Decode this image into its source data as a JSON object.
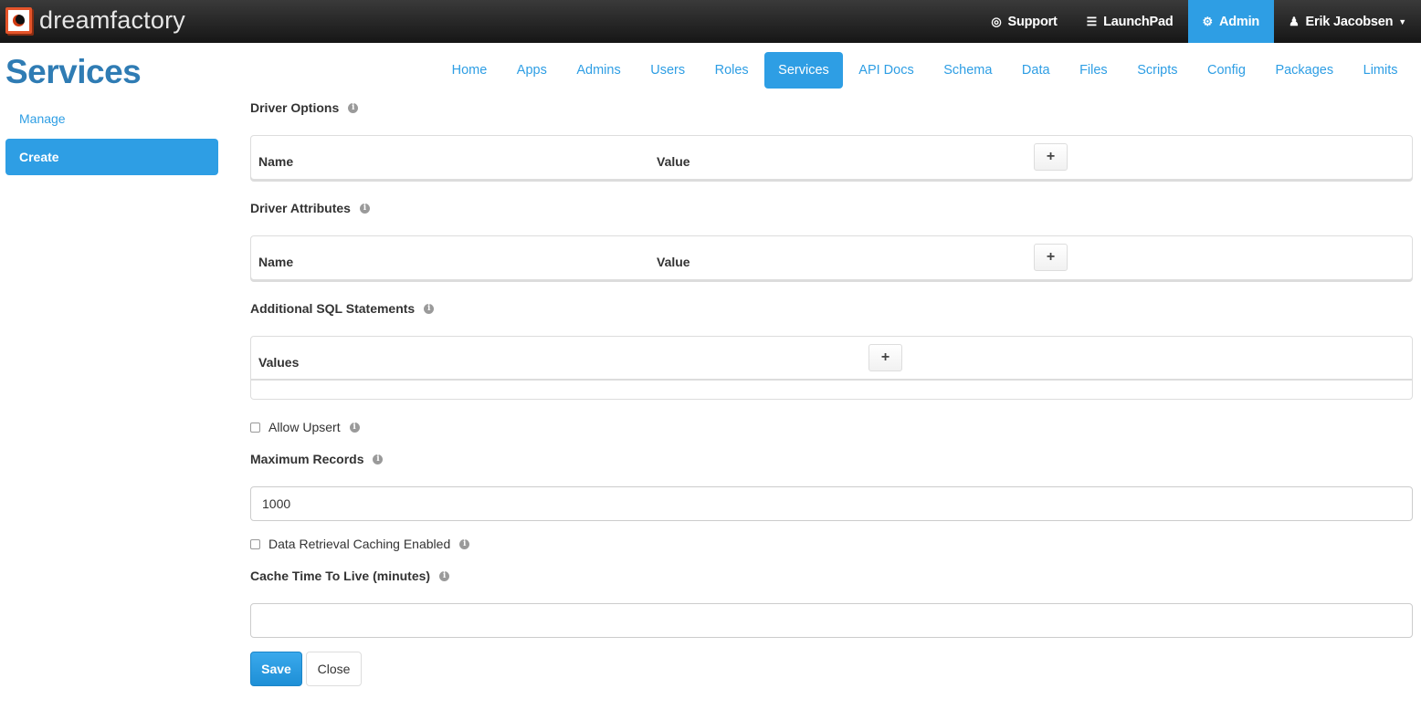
{
  "brand": {
    "name": "dreamfactory"
  },
  "topnav": {
    "items": [
      {
        "label": "Support",
        "icon": "lifebuoy-icon"
      },
      {
        "label": "LaunchPad",
        "icon": "menu-icon"
      },
      {
        "label": "Admin",
        "icon": "gear-icon",
        "active": true
      },
      {
        "label": "Erik Jacobsen",
        "icon": "user-icon",
        "dropdown": true
      }
    ]
  },
  "page": {
    "title": "Services"
  },
  "sidenav": {
    "items": [
      {
        "label": "Manage",
        "active": false
      },
      {
        "label": "Create",
        "active": true
      }
    ]
  },
  "tabs": [
    {
      "label": "Home"
    },
    {
      "label": "Apps"
    },
    {
      "label": "Admins"
    },
    {
      "label": "Users"
    },
    {
      "label": "Roles"
    },
    {
      "label": "Services",
      "active": true
    },
    {
      "label": "API Docs"
    },
    {
      "label": "Schema"
    },
    {
      "label": "Data"
    },
    {
      "label": "Files"
    },
    {
      "label": "Scripts"
    },
    {
      "label": "Config"
    },
    {
      "label": "Packages"
    },
    {
      "label": "Limits"
    }
  ],
  "form": {
    "driver_options": {
      "label": "Driver Options",
      "columns": [
        "Name",
        "Value"
      ],
      "add_label": "+"
    },
    "driver_attributes": {
      "label": "Driver Attributes",
      "columns": [
        "Name",
        "Value"
      ],
      "add_label": "+"
    },
    "additional_sql": {
      "label": "Additional SQL Statements",
      "columns": [
        "Values"
      ],
      "add_label": "+"
    },
    "allow_upsert": {
      "label": "Allow Upsert",
      "checked": false
    },
    "max_records": {
      "label": "Maximum Records",
      "value": "1000"
    },
    "caching_enabled": {
      "label": "Data Retrieval Caching Enabled",
      "checked": false
    },
    "cache_ttl": {
      "label": "Cache Time To Live (minutes)",
      "value": ""
    },
    "buttons": {
      "save": "Save",
      "close": "Close"
    }
  },
  "icons": {
    "info": "i"
  },
  "colors": {
    "accent": "#2e9ee4",
    "title": "#2f7cb4",
    "navbar": "#1e1e1e"
  }
}
